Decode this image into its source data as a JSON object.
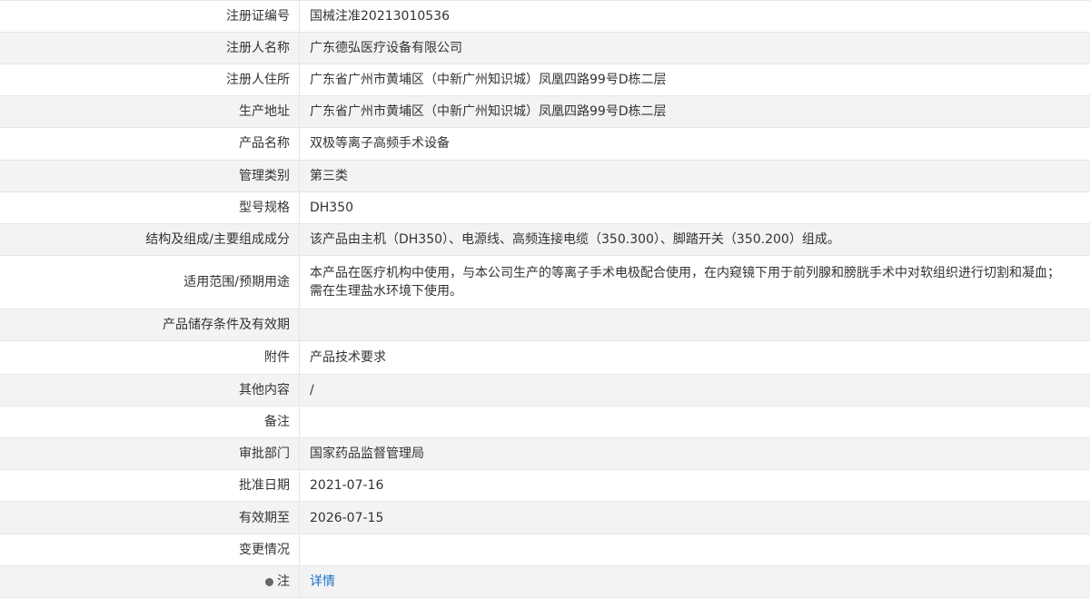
{
  "records": {
    "reg_no": {
      "label": "注册证编号",
      "value": "国械注准20213010536"
    },
    "registrant_name": {
      "label": "注册人名称",
      "value": "广东德弘医疗设备有限公司"
    },
    "registrant_address": {
      "label": "注册人住所",
      "value": "广东省广州市黄埔区（中新广州知识城）凤凰四路99号D栋二层"
    },
    "production_address": {
      "label": "生产地址",
      "value": "广东省广州市黄埔区（中新广州知识城）凤凰四路99号D栋二层"
    },
    "product_name": {
      "label": "产品名称",
      "value": "双极等离子高频手术设备"
    },
    "management_class": {
      "label": "管理类别",
      "value": "第三类"
    },
    "model_spec": {
      "label": "型号规格",
      "value": "DH350"
    },
    "structure": {
      "label": "结构及组成/主要组成成分",
      "value": "该产品由主机（DH350）、电源线、高频连接电缆（350.300）、脚踏开关（350.200）组成。"
    },
    "intended_use": {
      "label": "适用范围/预期用途",
      "value_line1": "本产品在医疗机构中使用，与本公司生产的等离子手术电极配合使用，在内窥镜下用于前列腺和膀胱手术中对软组织进行切割和凝血；",
      "value_line2": "需在生理盐水环境下使用。"
    },
    "storage": {
      "label": "产品储存条件及有效期",
      "value": ""
    },
    "attachment": {
      "label": "附件",
      "value": "产品技术要求"
    },
    "other": {
      "label": "其他内容",
      "value": "/"
    },
    "remarks": {
      "label": "备注",
      "value": ""
    },
    "approval_dept": {
      "label": "审批部门",
      "value": "国家药品监督管理局"
    },
    "approval_date": {
      "label": "批准日期",
      "value": "2021-07-16"
    },
    "valid_until": {
      "label": "有效期至",
      "value": "2026-07-15"
    },
    "change_info": {
      "label": "变更情况",
      "value": ""
    },
    "note": {
      "label": "注",
      "link_text": "详情",
      "icon": "note-bulb-icon"
    }
  }
}
